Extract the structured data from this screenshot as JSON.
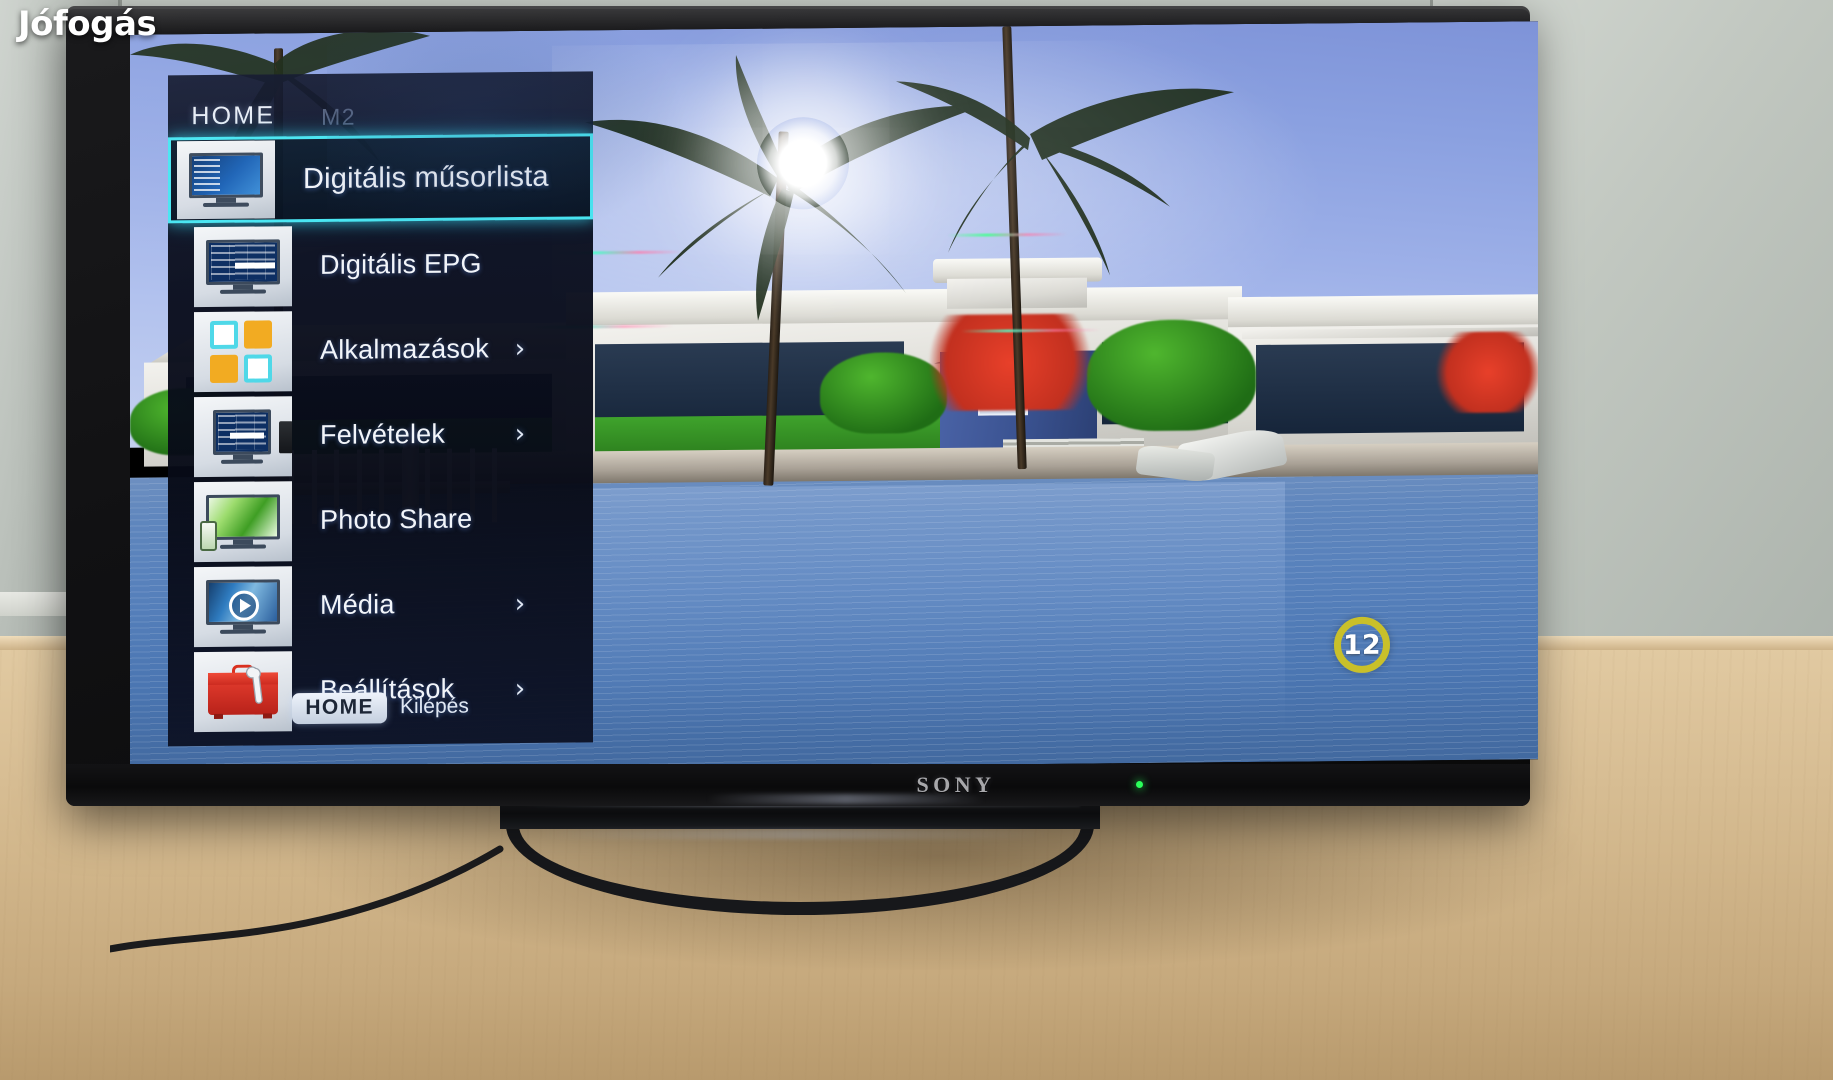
{
  "watermark": {
    "text": "Jófogás"
  },
  "device": {
    "brand_logo": "SONY",
    "power_led": "power-led-green"
  },
  "tv_menu": {
    "header": "HOME",
    "channel_label": "M2",
    "items": [
      {
        "label": "Digitális műsorlista",
        "icon": "tv-channel-list-icon",
        "selected": true,
        "has_submenu": false,
        "chevron": ""
      },
      {
        "label": "Digitális EPG",
        "icon": "tv-epg-grid-icon",
        "selected": false,
        "has_submenu": false,
        "chevron": ""
      },
      {
        "label": "Alkalmazások",
        "icon": "app-tiles-icon",
        "selected": false,
        "has_submenu": true,
        "chevron": "›"
      },
      {
        "label": "Felvételek",
        "icon": "tv-usb-recording-icon",
        "selected": false,
        "has_submenu": true,
        "chevron": "›"
      },
      {
        "label": "Photo Share",
        "icon": "photo-share-icon",
        "selected": false,
        "has_submenu": false,
        "chevron": ""
      },
      {
        "label": "Média",
        "icon": "media-play-icon",
        "selected": false,
        "has_submenu": true,
        "chevron": "›"
      },
      {
        "label": "Beállítások",
        "icon": "settings-toolbox-icon",
        "selected": false,
        "has_submenu": true,
        "chevron": "›"
      }
    ],
    "footer": {
      "key_badge": "HOME",
      "key_action": "Kilépés"
    },
    "colors": {
      "selection_border": "#49e6f2",
      "panel_bg": "#0a0e1e",
      "label_text": "#f2f5fa",
      "header_text": "#e8edf6"
    }
  },
  "broadcast": {
    "rating_badge": "12",
    "rating_badge_color": "#c9c02a",
    "scene_description": "Tropical waterfront: palm trees, sun flare, white houses, blue boathouse, white picket fence, moored boat, calm blue water"
  }
}
